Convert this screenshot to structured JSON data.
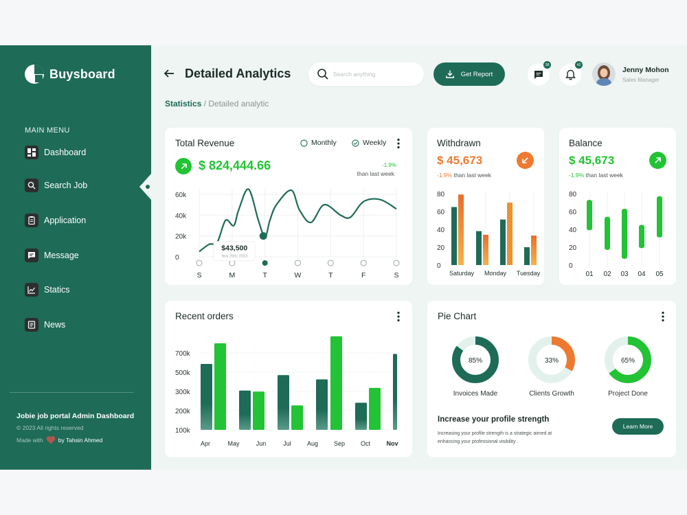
{
  "brand": {
    "name": "Buysboard"
  },
  "menu": {
    "title": "MAIN MENU",
    "items": [
      {
        "label": "Dashboard",
        "icon": "dashboard-icon"
      },
      {
        "label": "Search Job",
        "icon": "search-icon"
      },
      {
        "label": "Application",
        "icon": "clipboard-icon"
      },
      {
        "label": "Message",
        "icon": "message-icon"
      },
      {
        "label": "Statics",
        "icon": "chart-icon"
      },
      {
        "label": "News",
        "icon": "news-icon"
      }
    ]
  },
  "footer": {
    "title": "Jobie job portal Admin Dashboard",
    "copyright": "© 2023  All rights reserved",
    "made_prefix": "Made with",
    "made_suffix": "by Tahsin Ahmed"
  },
  "header": {
    "title": "Detailed Analytics",
    "search_placeholder": "Search anything",
    "report_button": "Get Report",
    "messages_count": "38",
    "notifications_count": "42",
    "user_name": "Jenny Mohon",
    "user_role": "Sales Manager"
  },
  "breadcrumb": {
    "current": "Statistics",
    "separator": " / ",
    "rest": "Detailed analytic"
  },
  "revenue": {
    "title": "Total Revenue",
    "option_monthly": "Monthly",
    "option_weekly": "Weekly",
    "amount": "$ 824,444.66",
    "change": "-1.9%",
    "change_note": "than last week",
    "tooltip_value": "$43,500",
    "tooltip_date": "Nov 25th, 2023"
  },
  "withdrawn": {
    "title": "Withdrawn",
    "amount": "$ 45,673",
    "change": "-1.9%",
    "change_note": "than last week"
  },
  "balance": {
    "title": "Balance",
    "amount": "$ 45,673",
    "change": "-1.9%",
    "change_note": "than last week"
  },
  "orders": {
    "title": "Recent orders"
  },
  "pie": {
    "title": "Pie Chart",
    "donuts": [
      {
        "label": "Invoices Made",
        "value": 85,
        "text": "85%",
        "color": "#1e6b57"
      },
      {
        "label": "Clients Growth",
        "value": 33,
        "text": "33%",
        "color": "#ee7a31"
      },
      {
        "label": "Project Done",
        "value": 65,
        "text": "65%",
        "color": "#22c334"
      }
    ],
    "promo_title": "Increase your profile strength",
    "promo_text_1": "Increasing your profile strength is a strategic aimed at",
    "promo_text_2": "enhancing your professional visibility .",
    "promo_button": "Learn More"
  },
  "colors": {
    "primary": "#1e6b57",
    "green": "#22c334",
    "orange": "#ee7a31",
    "negative": "#e8612c"
  },
  "chart_data": [
    {
      "type": "line",
      "title": "Total Revenue",
      "x": [
        "S",
        "M",
        "T",
        "W",
        "T",
        "F",
        "S"
      ],
      "yticks": [
        "60k",
        "40k",
        "20k",
        "0"
      ],
      "ylim": [
        0,
        70000
      ],
      "series": [
        {
          "points": [
            [
              0,
              5000
            ],
            [
              0.3,
              12000
            ],
            [
              0.55,
              14000
            ],
            [
              0.8,
              35000
            ],
            [
              1.05,
              30000
            ],
            [
              1.2,
              45000
            ],
            [
              1.5,
              65000
            ],
            [
              1.8,
              35000
            ],
            [
              2.0,
              19000
            ],
            [
              2.15,
              35000
            ],
            [
              2.35,
              50000
            ],
            [
              2.8,
              64000
            ],
            [
              3.05,
              45000
            ],
            [
              3.4,
              33000
            ],
            [
              3.8,
              50000
            ],
            [
              4.3,
              40000
            ],
            [
              4.6,
              38000
            ],
            [
              5.0,
              53000
            ],
            [
              5.5,
              55000
            ],
            [
              6.0,
              46000
            ]
          ]
        }
      ],
      "highlight": {
        "x": "T",
        "value": 43500
      }
    },
    {
      "type": "bar",
      "title": "Withdrawn",
      "categories": [
        "Saturday",
        "",
        "Monday",
        "",
        "Tuesday"
      ],
      "yticks": [
        "80",
        "60",
        "40",
        "20",
        "0"
      ],
      "ylim": [
        0,
        80
      ],
      "series": [
        {
          "values": [
            65,
            38,
            51,
            20
          ]
        },
        {
          "values": [
            79,
            34,
            70,
            33
          ]
        }
      ]
    },
    {
      "type": "bar",
      "title": "Balance",
      "categories": [
        "01",
        "02",
        "03",
        "04",
        "05"
      ],
      "yticks": [
        "80",
        "60",
        "40",
        "20",
        "0"
      ],
      "ylim": [
        0,
        80
      ],
      "ranges": [
        [
          39,
          73
        ],
        [
          17,
          54
        ],
        [
          7,
          63
        ],
        [
          19,
          45
        ],
        [
          31,
          77
        ]
      ]
    },
    {
      "type": "bar",
      "title": "Recent orders",
      "categories": [
        "Apr",
        "May",
        "Jun",
        "Jul",
        "Aug",
        "Sep",
        "Oct",
        "Nov"
      ],
      "yticks": [
        "700k",
        "500k",
        "300k",
        "200k",
        "100k"
      ],
      "series": [
        {
          "values": [
            620,
            370,
            515,
            395,
            715
          ]
        },
        {
          "values": [
            815,
            360,
            230,
            475,
            255
          ]
        }
      ],
      "notes": "y values are in thousands"
    },
    {
      "type": "pie",
      "title": "Pie Chart",
      "slices": [
        {
          "label": "Invoices Made",
          "value": 85
        },
        {
          "label": "Clients Growth",
          "value": 33
        },
        {
          "label": "Project Done",
          "value": 65
        }
      ]
    }
  ]
}
